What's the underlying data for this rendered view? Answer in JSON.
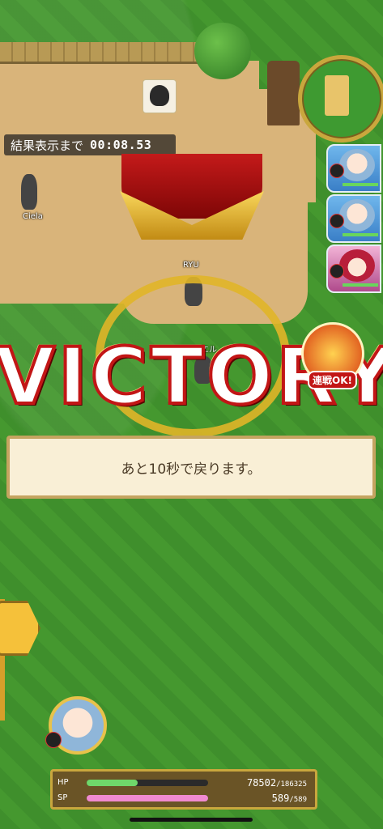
{
  "timer": {
    "label": "結果表示まで",
    "time": "00:08.53"
  },
  "characters": [
    {
      "name": "Ciela"
    },
    {
      "name": "RYU"
    },
    {
      "name": "エル"
    }
  ],
  "victory": {
    "letters": [
      "V",
      "I",
      "C",
      "T",
      "O",
      "R",
      "Y"
    ]
  },
  "chain_badge": {
    "label": "連戦OK!"
  },
  "message": "あと10秒で戻ります。",
  "status": {
    "hp": {
      "label": "HP",
      "current": "78502",
      "max": "186325",
      "fraction": 0.42
    },
    "sp": {
      "label": "SP",
      "current": "589",
      "max": "589",
      "fraction": 1.0
    }
  },
  "colors": {
    "hp": "#6fd86a",
    "sp": "#f08ad0",
    "victory_outline": "#c21616"
  }
}
